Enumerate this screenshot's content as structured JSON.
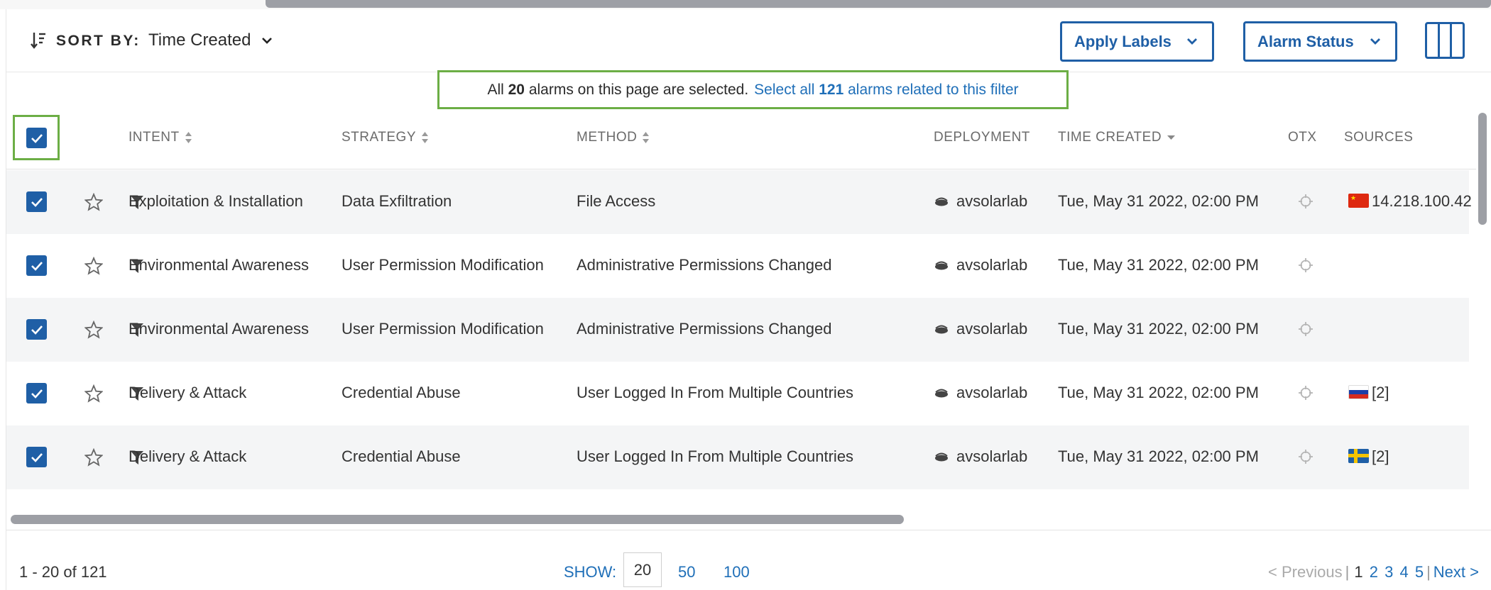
{
  "toolbar": {
    "sort_label": "SORT BY:",
    "sort_value": "Time Created",
    "apply_labels": "Apply Labels",
    "alarm_status": "Alarm Status"
  },
  "banner": {
    "prefix": "All",
    "count": "20",
    "middle": "alarms on this page are selected.",
    "link_prefix": "Select all",
    "link_count": "121",
    "link_suffix": "alarms related to this filter"
  },
  "columns": {
    "intent": "INTENT",
    "strategy": "STRATEGY",
    "method": "METHOD",
    "deployment": "DEPLOYMENT",
    "time_created": "TIME CREATED",
    "otx": "OTX",
    "sources": "SOURCES"
  },
  "rows": [
    {
      "intent": "Exploitation & Installation",
      "strategy": "Data Exfiltration",
      "method": "File Access",
      "deployment": "avsolarlab",
      "time": "Tue, May 31 2022, 02:00 PM",
      "source": "14.218.100.42",
      "flag": "cn"
    },
    {
      "intent": "Environmental Awareness",
      "strategy": "User Permission Modification",
      "method": "Administrative Permissions Changed",
      "deployment": "avsolarlab",
      "time": "Tue, May 31 2022, 02:00 PM",
      "source": "",
      "flag": ""
    },
    {
      "intent": "Environmental Awareness",
      "strategy": "User Permission Modification",
      "method": "Administrative Permissions Changed",
      "deployment": "avsolarlab",
      "time": "Tue, May 31 2022, 02:00 PM",
      "source": "",
      "flag": ""
    },
    {
      "intent": "Delivery & Attack",
      "strategy": "Credential Abuse",
      "method": "User Logged In From Multiple Countries",
      "deployment": "avsolarlab",
      "time": "Tue, May 31 2022, 02:00 PM",
      "source": "[2]",
      "flag": "ru"
    },
    {
      "intent": "Delivery & Attack",
      "strategy": "Credential Abuse",
      "method": "User Logged In From Multiple Countries",
      "deployment": "avsolarlab",
      "time": "Tue, May 31 2022, 02:00 PM",
      "source": "[2]",
      "flag": "se"
    }
  ],
  "footer": {
    "range": "1 - 20 of 121",
    "show_label": "SHOW:",
    "show_selected": "20",
    "show_options": [
      "50",
      "100"
    ],
    "previous": "< Previous",
    "pages": [
      "1",
      "2",
      "3",
      "4",
      "5"
    ],
    "next": "Next >"
  },
  "colors": {
    "accent": "#1f5fa6",
    "link": "#1f6fb8",
    "highlight": "#6cae45"
  }
}
